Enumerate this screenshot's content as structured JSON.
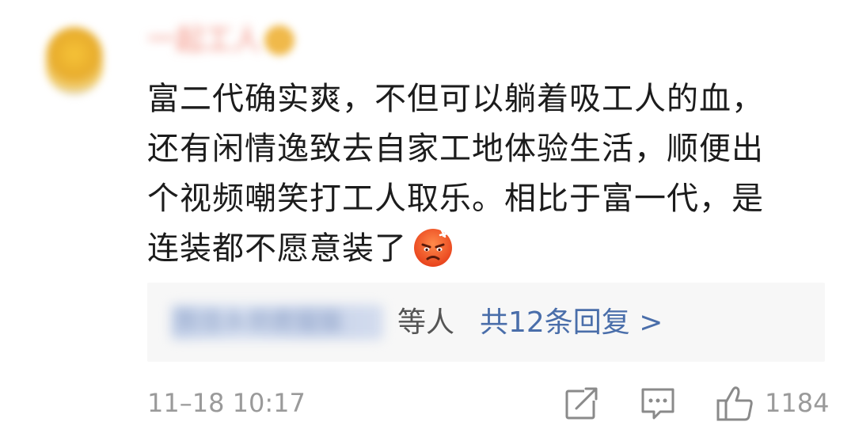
{
  "comment": {
    "username": "一起工人",
    "avatar_icon": "blurred-avatar",
    "text_lines": [
      "富二代确实爽，不但可以躺着吸工人的血，",
      "还有闲情逸致去自家工地体验生活，顺便出",
      "个视频嘲笑打工人取乐。相比于富一代，是",
      "连装都不愿意装了"
    ],
    "emoji": "angry-face-emoji",
    "replies": {
      "names": "陈佳永朋鹿猫猫",
      "others_label": "等人",
      "total_label": "共12条回复 >"
    },
    "timestamp": "11–18 10:17",
    "actions": {
      "share_icon": "share-icon",
      "reply_icon": "comment-icon",
      "like_icon": "thumbs-up-icon",
      "like_count": "1184"
    }
  },
  "colors": {
    "reply_link": "#4a6eaa",
    "meta_gray": "#9a9a9a",
    "reply_bg": "#f7f7f7"
  }
}
